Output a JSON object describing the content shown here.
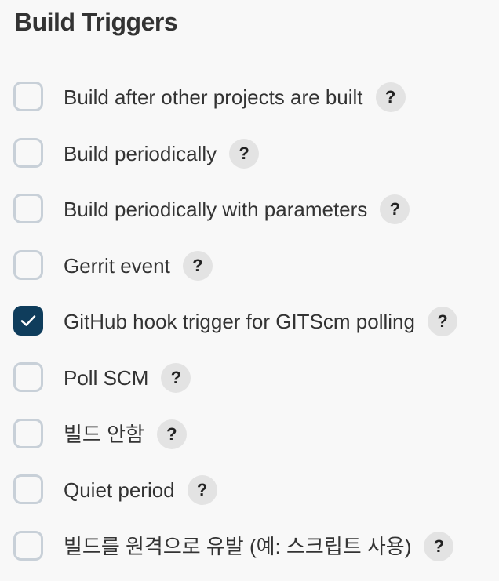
{
  "section": {
    "title": "Build Triggers"
  },
  "triggers": [
    {
      "label": "Build after other projects are built",
      "checked": false
    },
    {
      "label": "Build periodically",
      "checked": false
    },
    {
      "label": "Build periodically with parameters",
      "checked": false
    },
    {
      "label": "Gerrit event",
      "checked": false
    },
    {
      "label": "GitHub hook trigger for GITScm polling",
      "checked": true
    },
    {
      "label": "Poll SCM",
      "checked": false
    },
    {
      "label": "빌드 안함",
      "checked": false
    },
    {
      "label": "Quiet period",
      "checked": false
    },
    {
      "label": "빌드를 원격으로 유발 (예: 스크립트 사용)",
      "checked": false
    }
  ],
  "help": {
    "glyph": "?"
  },
  "colors": {
    "background": "#f8f8f8",
    "checkbox_border": "#c8d0d8",
    "checkbox_checked": "#0f3d5c",
    "help_bg": "#e3e3e3",
    "text": "#333333"
  }
}
